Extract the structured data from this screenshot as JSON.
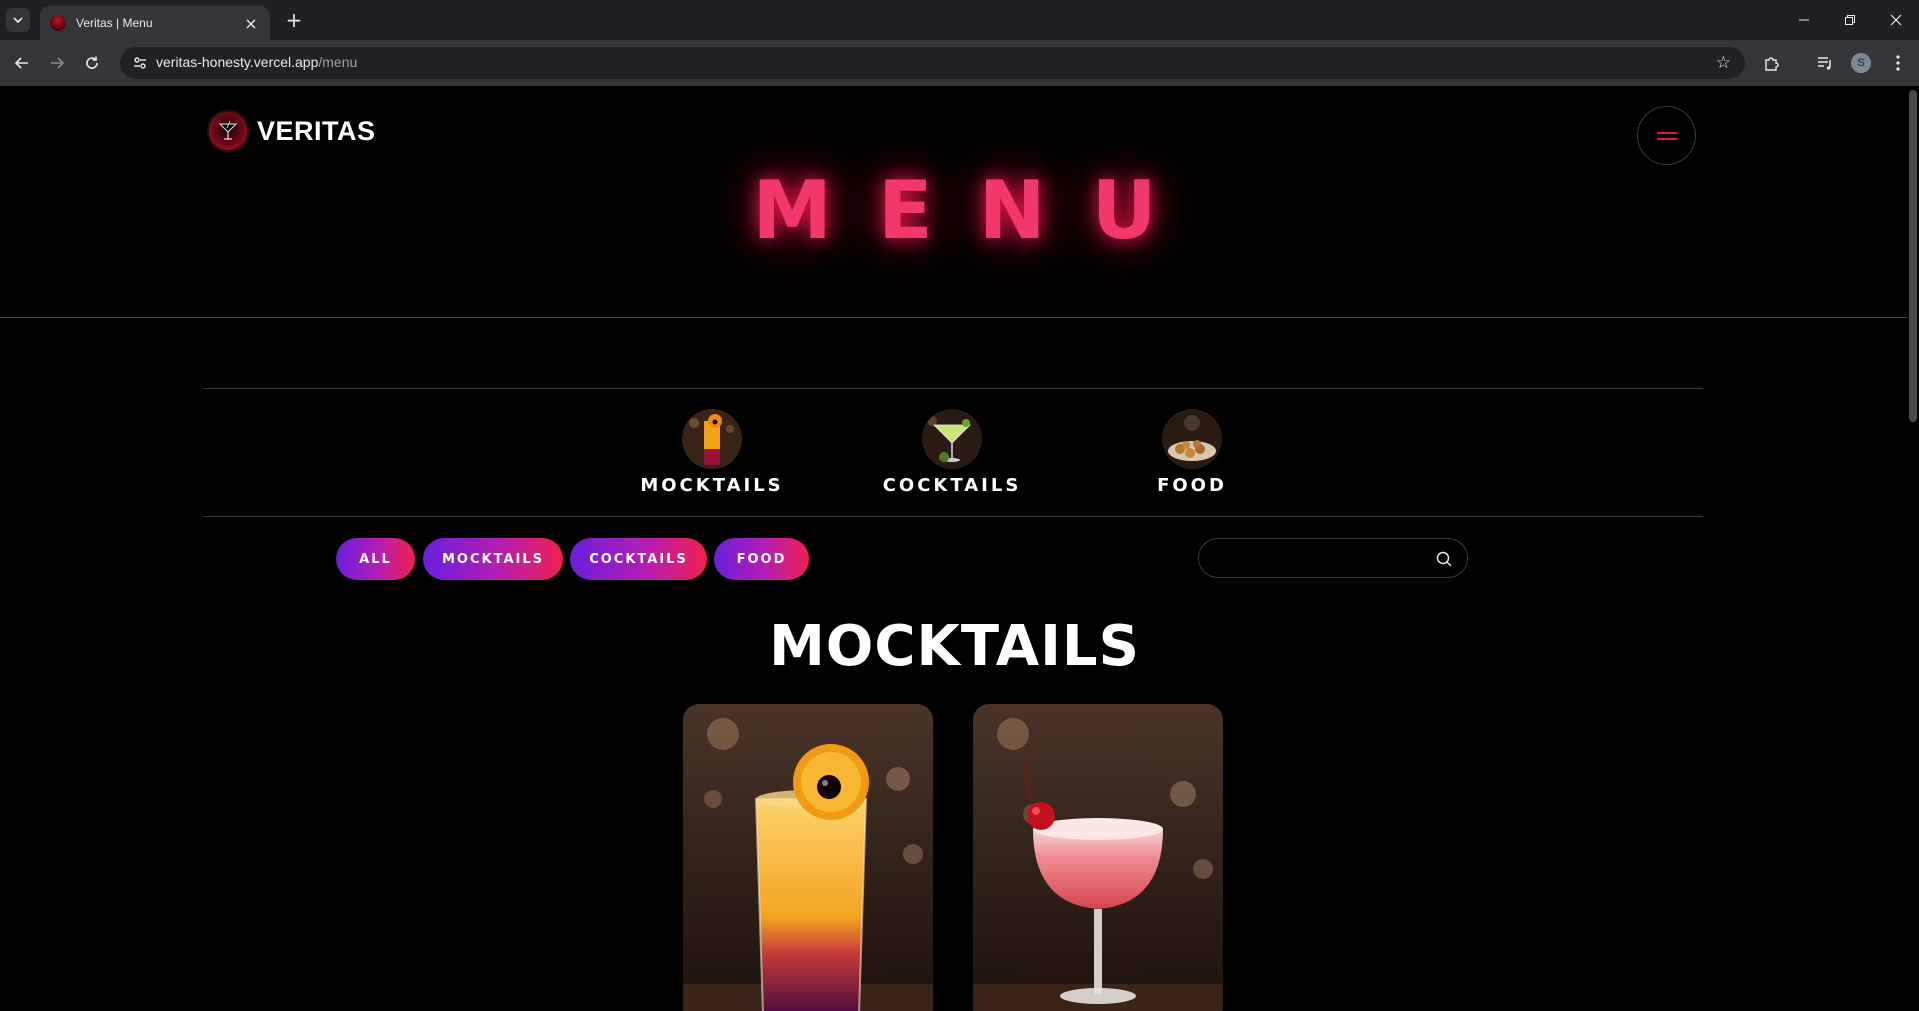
{
  "browser": {
    "tab_title": "Veritas | Menu",
    "url_host": "veritas-honesty.vercel.app",
    "url_path": "/menu",
    "profile_initial": "S"
  },
  "site": {
    "logo_text": "VERITAS",
    "page_title": "MENU",
    "accent_color": "#f2386a",
    "gradient_colors": [
      "#6a1de0",
      "#b51fb0",
      "#f0204e"
    ]
  },
  "categories": [
    {
      "label": "MOCKTAILS",
      "icon": "mocktail-thumbnail"
    },
    {
      "label": "COCKTAILS",
      "icon": "cocktail-thumbnail"
    },
    {
      "label": "FOOD",
      "icon": "food-thumbnail"
    }
  ],
  "filters": [
    {
      "label": "ALL"
    },
    {
      "label": "MOCKTAILS"
    },
    {
      "label": "COCKTAILS"
    },
    {
      "label": "FOOD"
    }
  ],
  "search": {
    "placeholder": "",
    "value": ""
  },
  "section": {
    "title": "MOCKTAILS",
    "items": [
      {
        "image": "orange-layered-mocktail-photo"
      },
      {
        "image": "pink-coupe-cherry-mocktail-photo"
      }
    ]
  }
}
